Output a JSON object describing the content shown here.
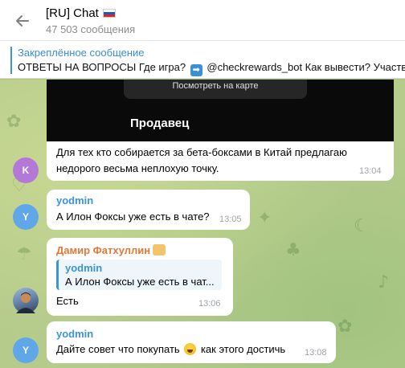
{
  "header": {
    "title": "[RU] Chat",
    "subtitle": "47 503 сообщения"
  },
  "pinned": {
    "title": "Закреплённое сообщение",
    "text_part1": "ОТВЕТЫ НА ВОПРОСЫ   Где игра?",
    "text_part2": "@checkrewards_bot   Как вывести? Участв"
  },
  "messages": [
    {
      "photo_button": "Посмотреть на карте",
      "photo_caption": "Продавец",
      "avatar_letter": "K",
      "avatar_color": "#b478d8",
      "line1": "Для тех кто собирается за бета-боксами в Китай предлагаю",
      "line2": "недорого весьма неплохую точку.",
      "time": "13:04"
    },
    {
      "sender": "yodmin",
      "sender_color": "#3a95d5",
      "avatar_letter": "Y",
      "avatar_color": "#5fa7e8",
      "text": "А Илон Фоксы уже есть в чате?",
      "time": "13:05"
    },
    {
      "sender": "Дамир Фатхуллин",
      "sender_color": "#e0783a",
      "reply_sender": "yodmin",
      "reply_text": "А Илон Фоксы уже есть в чат...",
      "text": "Есть",
      "time": "13:06"
    },
    {
      "sender": "yodmin",
      "sender_color": "#3a95d5",
      "avatar_letter": "Y",
      "avatar_color": "#5fa7e8",
      "text_part1": "Дайте совет что покупать",
      "text_part2": "как этого достичь",
      "time": "13:08"
    }
  ]
}
